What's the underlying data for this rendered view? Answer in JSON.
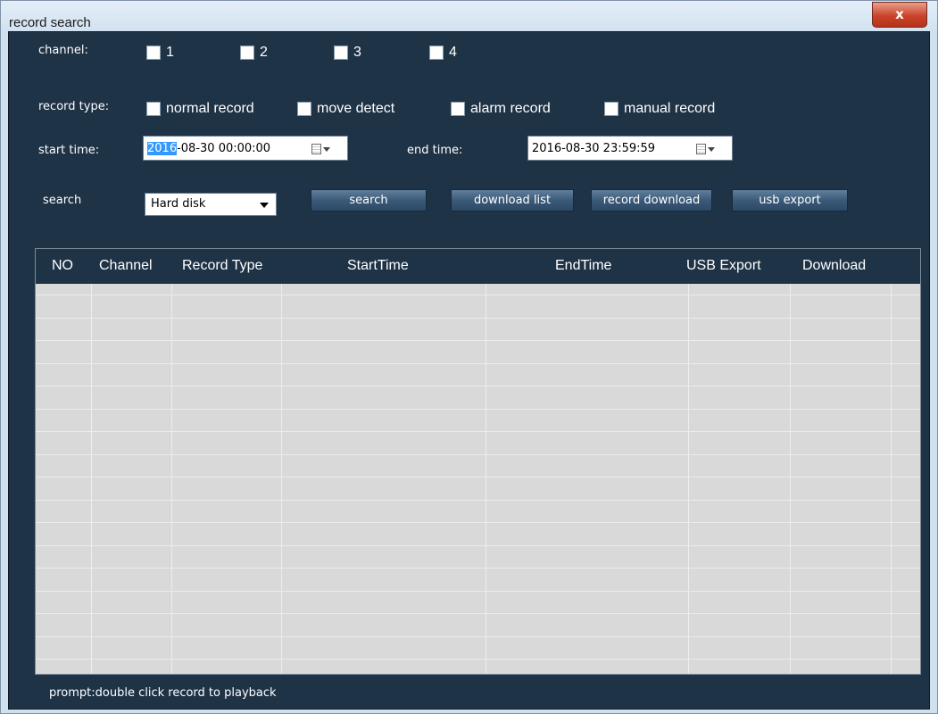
{
  "window": {
    "title": "record search",
    "close_label": "x"
  },
  "labels": {
    "channel": "channel:",
    "record_type": "record type:",
    "start_time": "start time:",
    "end_time": "end time:",
    "search": "search"
  },
  "channels": [
    "1",
    "2",
    "3",
    "4"
  ],
  "record_types": [
    "normal record",
    "move detect",
    "alarm record",
    "manual record"
  ],
  "start_time": {
    "selected": "2016",
    "rest": "-08-30 00:00:00"
  },
  "end_time": {
    "value": "2016-08-30 23:59:59"
  },
  "search_source": {
    "selected": "Hard disk"
  },
  "buttons": {
    "search": "search",
    "download_list": "download list",
    "record_download": "record download",
    "usb_export": "usb export"
  },
  "table": {
    "columns": [
      "NO",
      "Channel",
      "Record Type",
      "StartTime",
      "EndTime",
      "USB Export",
      "Download"
    ],
    "rows": []
  },
  "prompt": "prompt:double click record to playback",
  "colors": {
    "panel": "#1f3347",
    "grid": "#d9d9d9",
    "selection": "#3399ff",
    "close": "#c9432a"
  }
}
